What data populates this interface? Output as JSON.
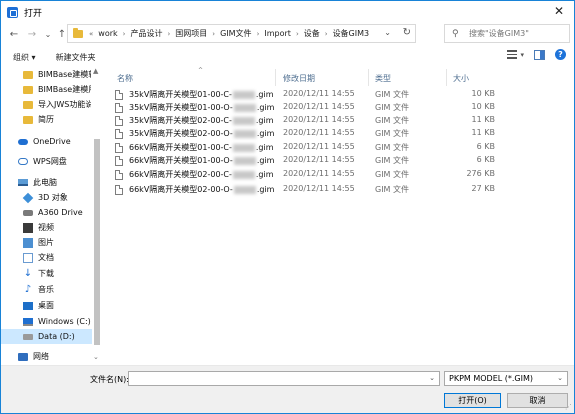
{
  "window": {
    "title": "打开",
    "close_glyph": "✕"
  },
  "nav": {
    "back": "←",
    "forward": "→",
    "recent": "⌄",
    "up": "↑",
    "overflow": "«",
    "breadcrumbs": [
      "work",
      "产品设计",
      "国网项目",
      "GIM文件",
      "Import",
      "设备",
      "设备GIM3"
    ],
    "search_placeholder": "搜索\"设备GIM3\""
  },
  "toolbar": {
    "organize": "组织 ▾",
    "new_folder": "新建文件夹"
  },
  "sidebar": {
    "items": [
      {
        "label": "BIMBase建模软件",
        "icon": "folder-icon"
      },
      {
        "label": "BIMBase建模用户",
        "icon": "folder-icon"
      },
      {
        "label": "导入JWS功能说明",
        "icon": "folder-icon"
      },
      {
        "label": "简历",
        "icon": "folder-icon"
      },
      {
        "label": "OneDrive",
        "icon": "onedrive-icon"
      },
      {
        "label": "WPS网盘",
        "icon": "cloud-icon"
      },
      {
        "label": "此电脑",
        "icon": "pc-icon"
      },
      {
        "label": "3D 对象",
        "icon": "cube-icon"
      },
      {
        "label": "A360 Drive",
        "icon": "drive-icon"
      },
      {
        "label": "视频",
        "icon": "video-icon"
      },
      {
        "label": "图片",
        "icon": "image-icon"
      },
      {
        "label": "文档",
        "icon": "document-icon"
      },
      {
        "label": "下载",
        "icon": "download-icon"
      },
      {
        "label": "音乐",
        "icon": "music-icon"
      },
      {
        "label": "桌面",
        "icon": "desktop-icon"
      },
      {
        "label": "Windows (C:)",
        "icon": "windows-drive-icon"
      },
      {
        "label": "Data (D:)",
        "icon": "data-drive-icon",
        "selected": true
      },
      {
        "label": "网络",
        "icon": "network-icon"
      }
    ]
  },
  "columns": {
    "name": "名称",
    "date": "修改日期",
    "type": "类型",
    "size": "大小"
  },
  "files": [
    {
      "prefix": "35kV隔离开关模型01-00-C-",
      "suffix": ".gim",
      "date": "2020/12/11 14:55",
      "type": "GIM 文件",
      "size": "10 KB"
    },
    {
      "prefix": "35kV隔离开关模型01-00-O-",
      "suffix": ".gim",
      "date": "2020/12/11 14:55",
      "type": "GIM 文件",
      "size": "10 KB"
    },
    {
      "prefix": "35kV隔离开关模型02-00-C-",
      "suffix": ".gim",
      "date": "2020/12/11 14:55",
      "type": "GIM 文件",
      "size": "11 KB"
    },
    {
      "prefix": "35kV隔离开关模型02-00-O-",
      "suffix": ".gim",
      "date": "2020/12/11 14:55",
      "type": "GIM 文件",
      "size": "11 KB"
    },
    {
      "prefix": "66kV隔离开关模型01-00-C-",
      "suffix": ".gim",
      "date": "2020/12/11 14:55",
      "type": "GIM 文件",
      "size": "6 KB"
    },
    {
      "prefix": "66kV隔离开关模型01-00-O-",
      "suffix": ".gim",
      "date": "2020/12/11 14:55",
      "type": "GIM 文件",
      "size": "6 KB"
    },
    {
      "prefix": "66kV隔离开关模型02-00-C-",
      "suffix": ".gim",
      "date": "2020/12/11 14:55",
      "type": "GIM 文件",
      "size": "276 KB"
    },
    {
      "prefix": "66kV隔离开关模型02-00-O-",
      "suffix": ".gim",
      "date": "2020/12/11 14:55",
      "type": "GIM 文件",
      "size": "27 KB"
    }
  ],
  "footer": {
    "filename_label": "文件名(N):",
    "filename_value": "",
    "filetype": "PKPM MODEL (*.GIM)",
    "open_button": "打开(O)",
    "cancel_button": "取消"
  }
}
